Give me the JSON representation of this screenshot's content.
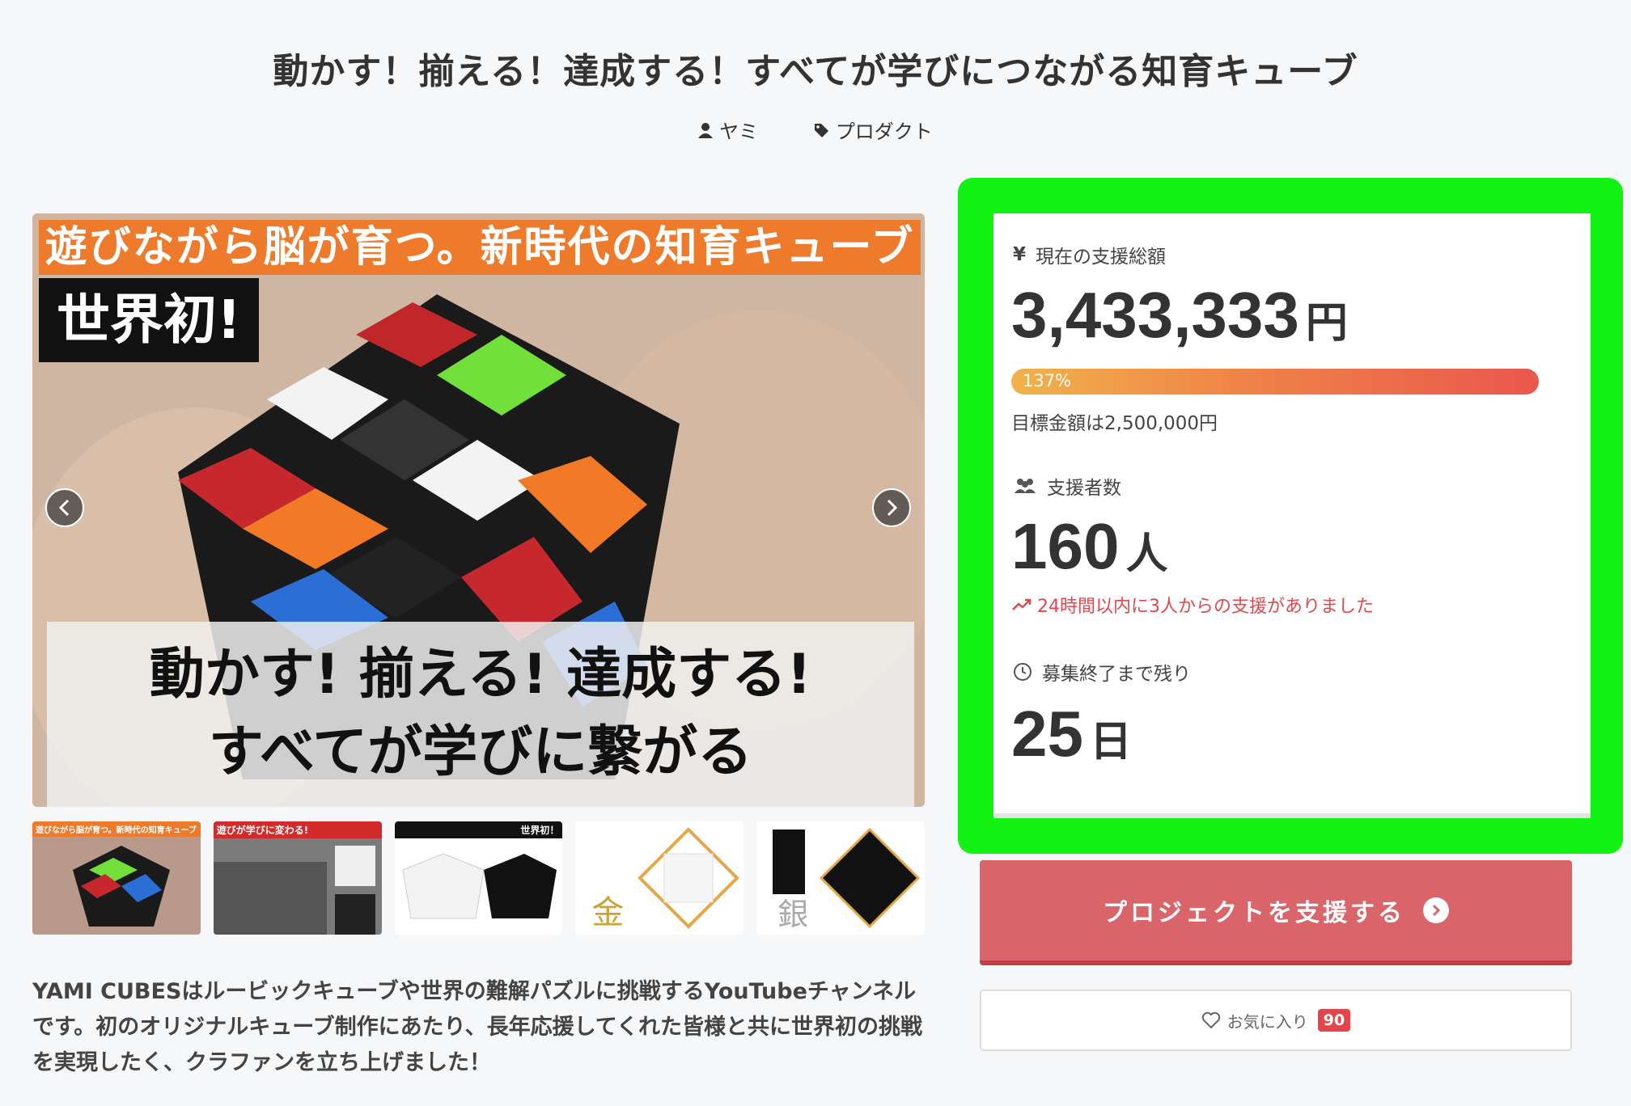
{
  "page_title": "動かす！揃える！達成する！すべてが学びにつながる知育キューブ",
  "meta": {
    "author": "ヤミ",
    "category": "プロダクト"
  },
  "hero": {
    "banner": "遊びながら脳が育つ。新時代の知育キューブ",
    "first": "世界初!",
    "caption_line1": "動かす! 揃える! 達成する!",
    "caption_line2": "すべてが学びに繋がる"
  },
  "thumbnails": [
    {
      "text": "遊びながら脳が育つ。新時代の知育キューブ"
    },
    {
      "text": "遊びが学びに変わる!"
    },
    {
      "text": "世界初！"
    },
    {
      "text": "金"
    },
    {
      "text": "銀"
    }
  ],
  "description": "YAMI CUBESはルービックキューブや世界の難解パズルに挑戦するYouTubeチャンネルです。初のオリジナルキューブ制作にあたり、長年応援してくれた皆様と共に世界初の挑戦を実現したく、クラファンを立ち上げました！",
  "stats": {
    "total_label": "現在の支援総額",
    "total_value": "3,433,333",
    "total_unit": "円",
    "progress_text": "137%",
    "progress_fraction": 1.0,
    "goal_text": "目標金額は2,500,000円",
    "supporters_label": "支援者数",
    "supporters_value": "160",
    "supporters_unit": "人",
    "recent_text": "24時間以内に3人からの支援がありました",
    "remaining_label": "募集終了まで残り",
    "remaining_value": "25",
    "remaining_unit": "日"
  },
  "buttons": {
    "support": "プロジェクトを支援する",
    "favorite": "お気に入り",
    "favorite_count": "90"
  },
  "colors": {
    "highlight_frame": "#12f212",
    "support_button": "#d9656a",
    "recent_text": "#e0484b",
    "badge": "#e2464c"
  }
}
